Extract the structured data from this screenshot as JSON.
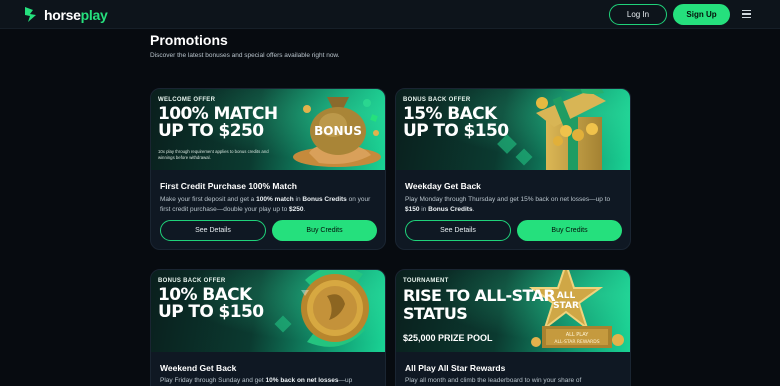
{
  "brand": {
    "name_part1": "horse",
    "name_part2": "play"
  },
  "header": {
    "login_label": "Log In",
    "signup_label": "Sign Up"
  },
  "page": {
    "title": "Promotions",
    "subtitle": "Discover the latest bonuses and special offers available right now."
  },
  "colors": {
    "accent": "#25e07d",
    "background": "#070b10",
    "card": "#0f1823"
  },
  "promos": [
    {
      "tag": "WELCOME OFFER",
      "headline_line1": "100% MATCH",
      "headline_line2": "UP TO $250",
      "fine_print": "10x play through requirement applies to bonus credits and winnings before withdrawal.",
      "art_label": "BONUS",
      "title": "First Credit Purchase 100% Match",
      "desc_a": "Make your first deposit and get a ",
      "desc_b": "100% match",
      "desc_c": " in ",
      "desc_d": "Bonus Credits",
      "desc_e": " on your first credit purchase—double your play up to ",
      "desc_f": "$250",
      "desc_g": ".",
      "details_label": "See Details",
      "buy_label": "Buy Credits",
      "art_icon": "money-bag-icon"
    },
    {
      "tag": "BONUS BACK OFFER",
      "headline_line1": "15% BACK",
      "headline_line2": "UP TO $150",
      "title": "Weekday Get Back",
      "desc_a": "Play Monday through Thursday and get 15% back on net losses—up to ",
      "desc_b": "$150",
      "desc_c": " in ",
      "desc_d": "Bonus Credits",
      "desc_e": ".",
      "details_label": "See Details",
      "buy_label": "Buy Credits",
      "art_icon": "gift-box-icon"
    },
    {
      "tag": "BONUS BACK OFFER",
      "headline_line1": "10% BACK",
      "headline_line2": "UP TO $150",
      "title": "Weekend Get Back",
      "desc_a": "Play Friday through Sunday and get ",
      "desc_b": "10% back on net losses",
      "desc_c": "—up",
      "art_icon": "coin-icon"
    },
    {
      "tag": "TOURNAMENT",
      "headline_line1": "RISE TO ALL-STAR",
      "headline_line2": "STATUS",
      "prize": "$25,000 PRIZE POOL",
      "art_label_1": "ALL",
      "art_label_2": "STAR",
      "art_label_3": "ALL PLAY",
      "art_label_4": "ALL-STAR REWARDS",
      "title": "All Play All Star Rewards",
      "desc_a": "Play all month and climb the leaderboard to win your share of",
      "art_icon": "star-trophy-icon"
    }
  ]
}
